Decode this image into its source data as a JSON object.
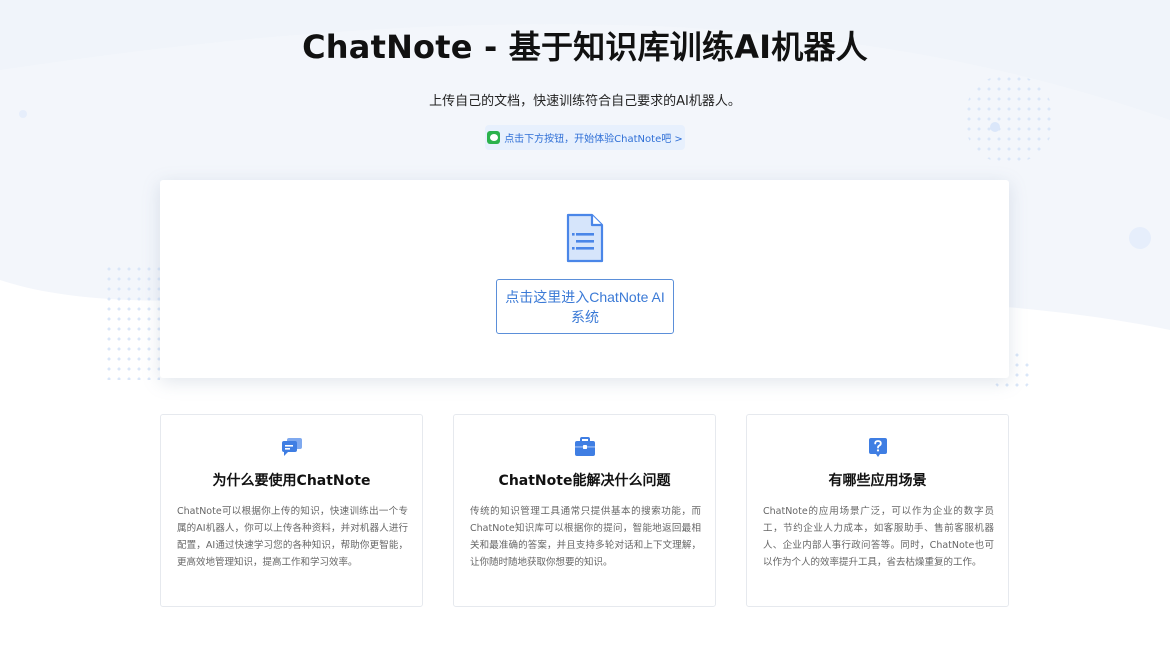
{
  "header": {
    "title": "ChatNote - 基于知识库训练AI机器人",
    "subtitle": "上传自己的文档，快速训练符合自己要求的AI机器人。",
    "hint": "点击下方按钮，开始体验ChatNote吧 >"
  },
  "main": {
    "enter_button_label": "点击这里进入ChatNote AI系统"
  },
  "features": [
    {
      "icon": "chat-bubbles-icon",
      "title": "为什么要使用ChatNote",
      "desc": "ChatNote可以根据你上传的知识，快速训练出一个专属的AI机器人，你可以上传各种资料，并对机器人进行配置，AI通过快速学习您的各种知识，帮助你更智能，更高效地管理知识，提高工作和学习效率。"
    },
    {
      "icon": "briefcase-icon",
      "title": "ChatNote能解决什么问题",
      "desc": "传统的知识管理工具通常只提供基本的搜索功能，而ChatNote知识库可以根据你的提问，智能地返回最相关和最准确的答案，并且支持多轮对话和上下文理解，让你随时随地获取你想要的知识。"
    },
    {
      "icon": "question-icon",
      "title": "有哪些应用场景",
      "desc": "ChatNote的应用场景广泛，可以作为企业的数字员工，节约企业人力成本，如客服助手、售前客服机器人、企业内部人事行政问答等。同时，ChatNote也可以作为个人的效率提升工具，省去枯燥重复的工作。"
    }
  ],
  "colors": {
    "accent": "#3b7ad6",
    "icon_blue": "#4a86e8",
    "hint_bg": "#e7f0fd",
    "wechat_green": "#2bb24c"
  }
}
